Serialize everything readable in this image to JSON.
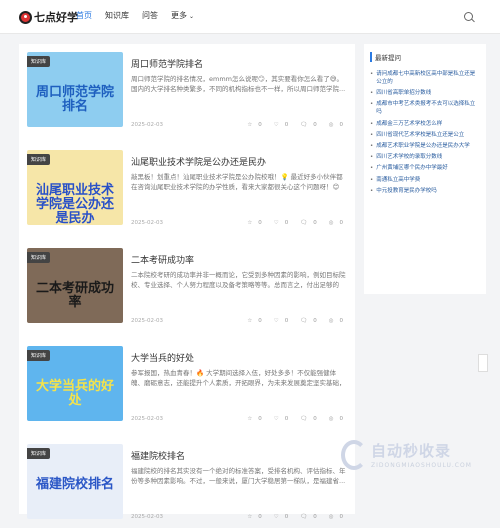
{
  "header": {
    "logo_text": "七点好学",
    "nav": [
      {
        "label": "首页",
        "active": true
      },
      {
        "label": "知识库",
        "active": false
      },
      {
        "label": "问答",
        "active": false
      },
      {
        "label": "更多",
        "active": false
      }
    ],
    "more_chevron": "⌄"
  },
  "cards": [
    {
      "tag": "知识库",
      "thumb_title": "周口师范学院排名",
      "title": "周口师范学院排名",
      "excerpt": "周口师范学院的排名情况，emmm怎么说呢😏，其实要看你怎么看了😅。国内的大学排名种类繁多，不同的机构指标也不一样，所以周口师范学院...",
      "date": "2025-02-03",
      "stats": [
        "0",
        "0",
        "0",
        "0"
      ],
      "thumb_bg": "#8ecdf0",
      "thumb_fg": "#1e5fbf"
    },
    {
      "tag": "知识库",
      "thumb_title": "汕尾职业技术学院是公办还是民办",
      "title": "汕尾职业技术学院是公办还是民办",
      "excerpt": "敲黑板！划重点！汕尾职业技术学院是公办院校哦！💡 最近好多小伙伴都在咨询汕尾职业技术学院的办学性质，看来大家都很关心这个问题呀！😊 毕...",
      "date": "2025-02-03",
      "stats": [
        "0",
        "0",
        "0",
        "0"
      ],
      "thumb_bg": "#f6e6a8",
      "thumb_fg": "#2850c8"
    },
    {
      "tag": "知识库",
      "thumb_title": "二本考研成功率",
      "title": "二本考研成功率",
      "excerpt": "二本院校考研的成功率并非一概而论，它受到多种因素的影响，例如目标院校、专业选择、个人努力程度以及备考策略等等。总而言之，付出足够的努...",
      "date": "2025-02-03",
      "stats": [
        "0",
        "0",
        "0",
        "0"
      ],
      "thumb_bg": "#7f6a58",
      "thumb_fg": "#1a1a1a"
    },
    {
      "tag": "知识库",
      "thumb_title": "大学当兵的好处",
      "title": "大学当兵的好处",
      "excerpt": "参军报国，热血青春！🔥 大学期间选择入伍，好处多多！不仅能强健体魄、磨砺意志，还能提升个人素质，开拓眼界，为未来发展奠定坚实基础，甚至还...",
      "date": "2025-02-03",
      "stats": [
        "0",
        "0",
        "0",
        "0"
      ],
      "thumb_bg": "#5fb5ee",
      "thumb_fg": "#f5e34a"
    },
    {
      "tag": "知识库",
      "thumb_title": "福建院校排名",
      "title": "福建院校排名",
      "excerpt": "福建院校的排名其实没有一个绝对的标准答案，受排名机构、评估指标、年份等多种因素影响。不过，一般来说，厦门大学稳居第一梯队，是福建省...",
      "date": "2025-02-03",
      "stats": [
        "0",
        "0",
        "0",
        "0"
      ],
      "thumb_bg": "#e8eef8",
      "thumb_fg": "#2a56c6"
    }
  ],
  "sidebar": {
    "title": "最新提问",
    "items": [
      "请问成都七中高新校区高中部是私立还是公立的",
      "四川省高职单招分数线",
      "成都市中考艺术类报考不去可以选择私立吗",
      "成都金三万艺术学校怎么样",
      "四川省现代艺术学校是私立还是公立",
      "成都艺术职业学院是公办还是民办大学",
      "四川艺术学校的录取分数线",
      "广州黄埔区哪个民办中学最好",
      "南通私立高中学费",
      "中元投教育是民办学校吗"
    ]
  },
  "watermark": {
    "text": "自动秒收录",
    "sub": "ZIDONGMIAOSHOULU.COM"
  }
}
